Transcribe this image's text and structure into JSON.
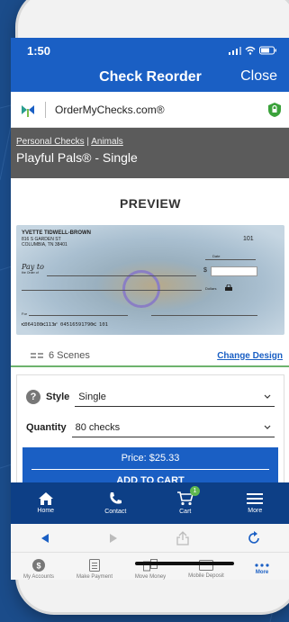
{
  "status_bar": {
    "time": "1:50"
  },
  "nav": {
    "title": "Check Reorder",
    "close_label": "Close"
  },
  "brand": {
    "name": "OrderMyChecks.com®"
  },
  "product": {
    "breadcrumb": [
      "Personal Checks",
      "Animals"
    ],
    "breadcrumb_sep": "|",
    "name": "Playful Pals® - Single"
  },
  "preview": {
    "title": "PREVIEW",
    "check": {
      "owner_name": "YVETTE TIDWELL-BROWN",
      "address_line1": "816 S GARDEN ST",
      "address_line2": "COLUMBIA, TN 38401",
      "check_number": "101",
      "date_label": "Date",
      "pay_to": "Pay to",
      "pay_to_sub": "the Order of",
      "dollar_sign": "$",
      "dollars_label": "Dollars",
      "for_label": "For",
      "micr": "⑆064108⑆113⑈ 04516591790⑆ 101"
    }
  },
  "scenes": {
    "label": "6 Scenes",
    "change_design": "Change Design"
  },
  "options": {
    "style_label": "Style",
    "style_value": "Single",
    "quantity_label": "Quantity",
    "quantity_value": "80 checks",
    "price": "Price: $25.33",
    "add_to_cart": "ADD TO CART"
  },
  "tabbar": {
    "items": [
      {
        "label": "Home",
        "icon": "home-icon"
      },
      {
        "label": "Contact",
        "icon": "phone-icon"
      },
      {
        "label": "Cart",
        "icon": "cart-icon",
        "badge": "1"
      },
      {
        "label": "More",
        "icon": "menu-icon"
      }
    ]
  },
  "app_tabs": {
    "items": [
      {
        "label": "My Accounts",
        "icon": "accounts-icon"
      },
      {
        "label": "Make Payment",
        "icon": "payment-icon"
      },
      {
        "label": "Move Money",
        "icon": "transfer-icon"
      },
      {
        "label": "Mobile Deposit",
        "icon": "deposit-icon"
      },
      {
        "label": "More",
        "icon": "more-dots-icon"
      }
    ]
  },
  "colors": {
    "primary_blue": "#1a5fc4",
    "tabbar_navy": "#0d3f86",
    "product_bar_gray": "#5b5b5b",
    "accent_green": "#6db36d",
    "lock_green": "#3aa23a"
  }
}
